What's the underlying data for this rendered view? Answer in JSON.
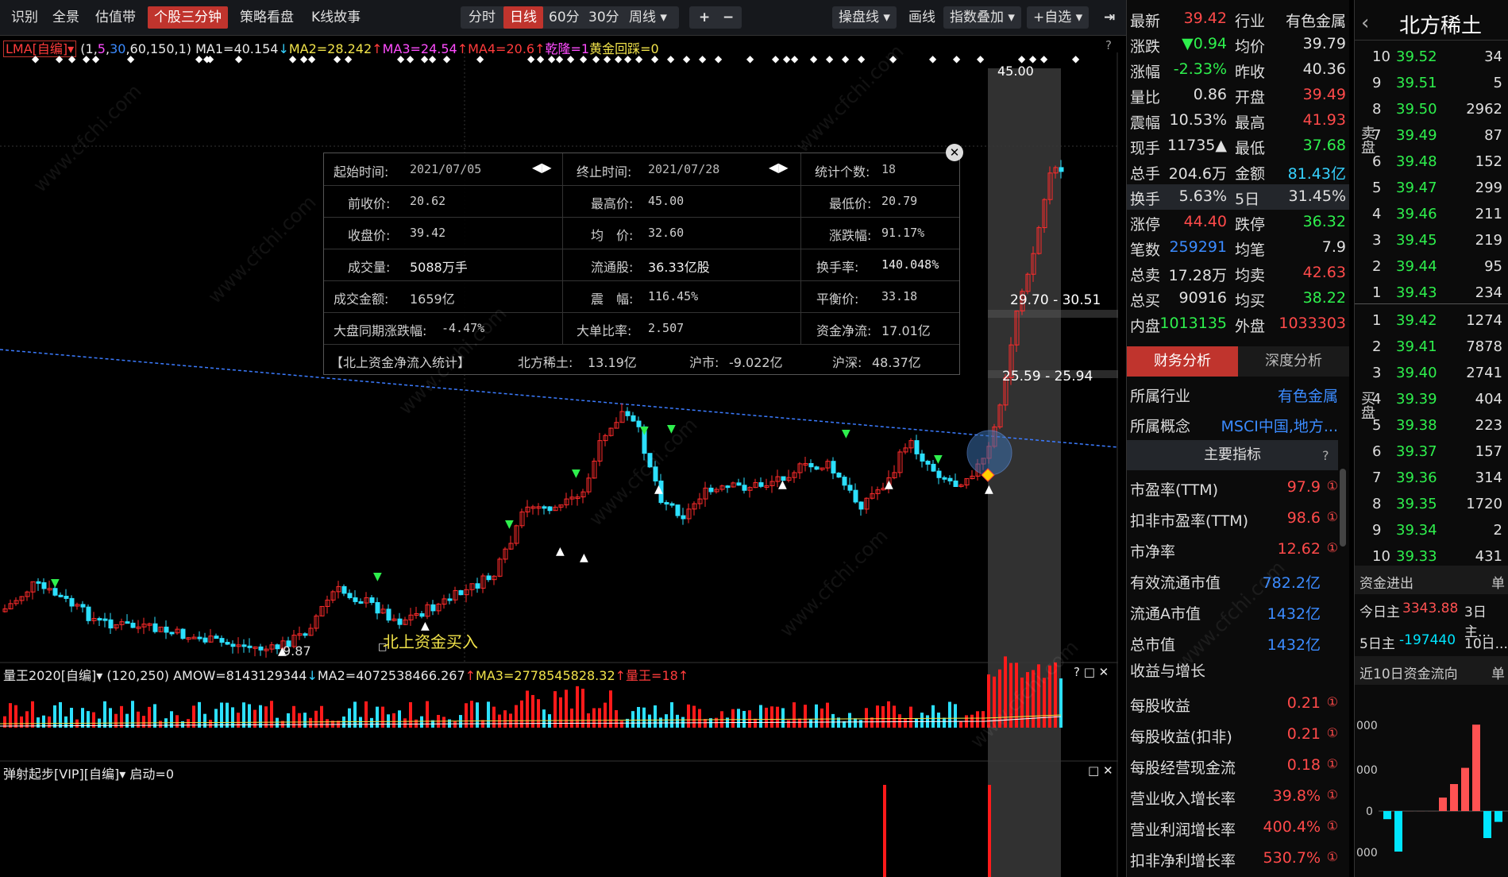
{
  "toolbar": {
    "left": [
      "识别",
      "全景",
      "估值带",
      "个股三分钟",
      "策略看盘",
      "K线故事"
    ],
    "periods": [
      "分时",
      "日线",
      "60分",
      "30分",
      "周线 ▾"
    ],
    "plus": "+",
    "minus": "−",
    "right": [
      "操盘线 ▾",
      "画线",
      "指数叠加 ▾",
      "+自选 ▾"
    ],
    "close_icon": "x-icon"
  },
  "indicator_main": {
    "name": "LMA[自编]▾",
    "params_open": "(1,",
    "p1": "5",
    "p2": "30",
    "params_rest": ",60,150,1)",
    "ma1": "MA1=40.154",
    "ma1_arrow": "↓",
    "ma2": "MA2=28.242",
    "ma2_arrow": "↑",
    "ma3": "MA3=24.54",
    "ma3_arrow": "↑",
    "ma4": "MA4=20.6",
    "ma4_arrow": "↑",
    "qianlong": "乾隆=1",
    "huangjin": "黄金回踩=0",
    "help": "?"
  },
  "price_labels": {
    "high": "45.00",
    "low": "9.87",
    "zone1": "29.70 - 30.51",
    "zone2": "25.59 - 25.94",
    "note": "北上资金买入"
  },
  "popup": {
    "start_label": "起始时间:",
    "start_value": "2021/07/05",
    "end_label": "终止时间:",
    "end_value": "2021/07/28",
    "count_label": "统计个数:",
    "count_value": "18",
    "prev_close_label": "前收价:",
    "prev_close": "20.62",
    "high_label": "最高价:",
    "high": "45.00",
    "low_label": "最低价:",
    "low": "20.79",
    "close_label": "收盘价:",
    "close": "39.42",
    "avg_label": "均　价:",
    "avg": "32.60",
    "chg_label": "涨跌幅:",
    "chg": "91.17%",
    "vol_label": "成交量:",
    "vol": "5088万手",
    "float_label": "流通股:",
    "float": "36.33亿股",
    "turnover_label": "换手率:",
    "turnover": "140.048%",
    "amount_label": "成交金额:",
    "amount": "1659亿",
    "amp_label": "震　幅:",
    "amp": "116.45%",
    "balance_label": "平衡价:",
    "balance": "33.18",
    "market_label": "大盘同期涨跌幅:",
    "market": "-4.47%",
    "bigratio_label": "大单比率:",
    "bigratio": "2.507",
    "netflow_label": "资金净流:",
    "netflow": "17.01亿",
    "north_label": "【北上资金净流入统计】",
    "n1_label": "北方稀土:",
    "n1": "13.19亿",
    "n2_label": "沪市:",
    "n2": "-9.022亿",
    "n3_label": "沪深:",
    "n3": "48.37亿"
  },
  "indicator_vol": {
    "name": "量王2020[自编]▾",
    "params": "(120,250)",
    "amow": "AMOW=8143129344",
    "amow_arrow": "↓",
    "ma2": "MA2=4072538466.267",
    "ma2_arrow": "↑",
    "ma3": "MA3=2778545828.32",
    "ma3_arrow": "↑",
    "lw": "量王=18",
    "lw_arrow": "↑",
    "ctrl": "? □ ✕"
  },
  "indicator_third": {
    "name": "弹射起步[VIP][自编]▾",
    "start": "启动=0",
    "ctrl": "□ ✕"
  },
  "quote": {
    "rows": [
      [
        "最新",
        "39.42",
        "行业",
        "有色金属"
      ],
      [
        "涨跌",
        "▼0.94",
        "均价",
        "39.79"
      ],
      [
        "涨幅",
        "-2.33%",
        "昨收",
        "40.36"
      ],
      [
        "量比",
        "0.86",
        "开盘",
        "39.49"
      ],
      [
        "震幅",
        "10.53%",
        "最高",
        "41.93"
      ],
      [
        "现手",
        "11735▲",
        "最低",
        "37.68"
      ],
      [
        "总手",
        "204.6万",
        "金额",
        "81.43亿"
      ],
      [
        "换手",
        "5.63%",
        "5日",
        "31.45%"
      ],
      [
        "涨停",
        "44.40",
        "跌停",
        "36.32"
      ],
      [
        "笔数",
        "259291",
        "均笔",
        "7.9"
      ],
      [
        "总卖",
        "17.28万",
        "均卖",
        "42.63"
      ],
      [
        "总买",
        "90916",
        "均买",
        "38.22"
      ],
      [
        "内盘",
        "1013135",
        "外盘",
        "1033303"
      ]
    ],
    "tab_fin": "财务分析",
    "tab_deep": "深度分析",
    "industry_label": "所属行业",
    "industry": "有色金属",
    "concept_label": "所属概念",
    "concept": "MSCI中国,地方...",
    "main_head": "主要指标",
    "main_help": "?",
    "metrics": [
      [
        "市盈率(TTM)",
        "97.9"
      ],
      [
        "扣非市盈率(TTM)",
        "98.6"
      ],
      [
        "市净率",
        "12.62"
      ],
      [
        "有效流通市值",
        "782.2亿"
      ],
      [
        "流通A市值",
        "1432亿"
      ],
      [
        "总市值",
        "1432亿"
      ]
    ],
    "growth_head": "收益与增长",
    "growth": [
      [
        "每股收益",
        "0.21"
      ],
      [
        "每股收益(扣非)",
        "0.21"
      ],
      [
        "每股经营现金流",
        "0.18"
      ],
      [
        "营业收入增长率",
        "39.8%"
      ],
      [
        "营业利润增长率",
        "400.4%"
      ],
      [
        "扣非净利增长率",
        "530.7%"
      ]
    ]
  },
  "book": {
    "title": "北方稀土",
    "back": "‹",
    "sell": [
      [
        "10",
        "39.52",
        "34"
      ],
      [
        "9",
        "39.51",
        "5"
      ],
      [
        "8",
        "39.50",
        "2962"
      ],
      [
        "7",
        "39.49",
        "87"
      ],
      [
        "6",
        "39.48",
        "152"
      ],
      [
        "5",
        "39.47",
        "299"
      ],
      [
        "4",
        "39.46",
        "211"
      ],
      [
        "3",
        "39.45",
        "219"
      ],
      [
        "2",
        "39.44",
        "95"
      ],
      [
        "1",
        "39.43",
        "234"
      ]
    ],
    "buy": [
      [
        "1",
        "39.42",
        "1274"
      ],
      [
        "2",
        "39.41",
        "7878"
      ],
      [
        "3",
        "39.40",
        "2741"
      ],
      [
        "4",
        "39.39",
        "404"
      ],
      [
        "5",
        "39.38",
        "223"
      ],
      [
        "6",
        "39.37",
        "157"
      ],
      [
        "7",
        "39.36",
        "314"
      ],
      [
        "8",
        "39.35",
        "1720"
      ],
      [
        "9",
        "39.34",
        "2"
      ],
      [
        "10",
        "39.33",
        "431"
      ]
    ],
    "sell_label": "卖盘",
    "buy_label": "买盘",
    "flow_head": "资金进出",
    "flow_unit": "单",
    "today_label": "今日主",
    "today": "3343.88",
    "d3_label": "3日主...",
    "d5_label": "5日主",
    "d5": "-197440",
    "d10_label": "10日...",
    "ten_head": "近10日资金流向",
    "ten_unit": "单",
    "ten_axis": [
      "000",
      "000",
      "0",
      "000"
    ],
    "ten_values": [
      -0.3,
      -1.5,
      0,
      0,
      0,
      0.5,
      1.0,
      1.6,
      3.2,
      -1.0,
      -0.4
    ],
    "colors": {
      "up": "#ff5252",
      "down": "#00e5ff"
    }
  },
  "colors": {
    "up": "#ff2b2b",
    "down": "#2ce0ff",
    "bg": "#000000",
    "accent": "#c0342d"
  }
}
